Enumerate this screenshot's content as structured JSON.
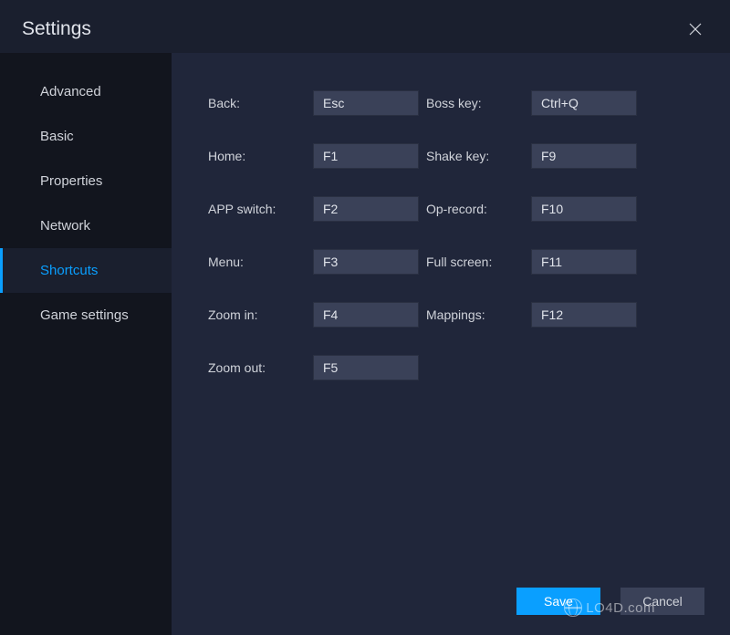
{
  "header": {
    "title": "Settings"
  },
  "sidebar": {
    "items": [
      {
        "label": "Advanced",
        "active": false
      },
      {
        "label": "Basic",
        "active": false
      },
      {
        "label": "Properties",
        "active": false
      },
      {
        "label": "Network",
        "active": false
      },
      {
        "label": "Shortcuts",
        "active": true
      },
      {
        "label": "Game settings",
        "active": false
      }
    ]
  },
  "shortcuts": {
    "left": [
      {
        "label": "Back:",
        "value": "Esc"
      },
      {
        "label": "Home:",
        "value": "F1"
      },
      {
        "label": "APP switch:",
        "value": "F2"
      },
      {
        "label": "Menu:",
        "value": "F3"
      },
      {
        "label": "Zoom in:",
        "value": "F4"
      },
      {
        "label": "Zoom out:",
        "value": "F5"
      }
    ],
    "right": [
      {
        "label": "Boss key:",
        "value": "Ctrl+Q"
      },
      {
        "label": "Shake key:",
        "value": "F9"
      },
      {
        "label": "Op-record:",
        "value": "F10"
      },
      {
        "label": "Full screen:",
        "value": "F11"
      },
      {
        "label": "Mappings:",
        "value": "F12"
      }
    ]
  },
  "buttons": {
    "save": "Save",
    "cancel": "Cancel"
  },
  "watermark": "LO4D.com"
}
